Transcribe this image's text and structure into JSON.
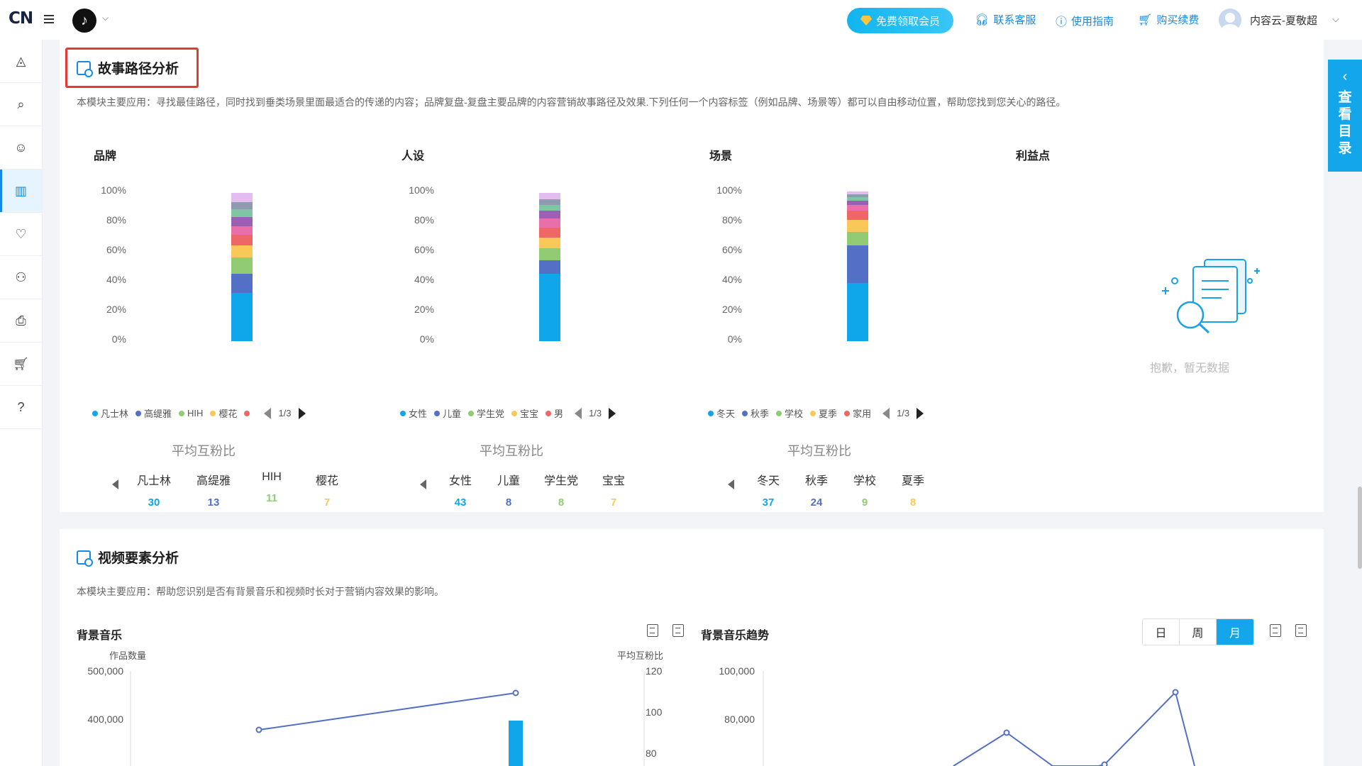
{
  "header": {
    "logo": "CN",
    "app_icon": "tiktok-icon",
    "vip_button": "免费领取会员",
    "links": [
      {
        "label": "联系客服",
        "icon": "headset-icon"
      },
      {
        "label": "使用指南",
        "icon": "help-icon"
      },
      {
        "label": "购买续费",
        "icon": "cart-icon"
      }
    ],
    "user_name": "内容云-夏敬超"
  },
  "sidebar": {
    "items": [
      {
        "icon": "overview-icon"
      },
      {
        "icon": "search-analysis-icon"
      },
      {
        "icon": "face-search-icon"
      },
      {
        "icon": "bar-chart-icon",
        "active": true
      },
      {
        "icon": "heartbeat-icon"
      },
      {
        "icon": "person-icon"
      },
      {
        "icon": "download-doc-icon"
      },
      {
        "icon": "cart-icon"
      },
      {
        "icon": "help-icon"
      }
    ]
  },
  "directory_tab": {
    "label": "查看目录"
  },
  "story_section": {
    "title": "故事路径分析",
    "description": "本模块主要应用：寻找最佳路径，同时找到垂类场景里面最适合的传递的内容；品牌复盘-复盘主要品牌的内容营销故事路径及效果.下列任何一个内容标签（例如品牌、场景等）都可以自由移动位置，帮助您找到您关心的路径。",
    "y_ticks": [
      "100%",
      "80%",
      "60%",
      "40%",
      "20%",
      "0%"
    ],
    "avg_title": "平均互粉比",
    "page_indicator": "1/3",
    "columns": [
      {
        "title": "品牌",
        "legend": [
          {
            "name": "凡士林",
            "color": "#0fa6ea"
          },
          {
            "name": "高缇雅",
            "color": "#5470c6"
          },
          {
            "name": "HIH",
            "color": "#91cc75"
          },
          {
            "name": "樱花",
            "color": "#fac858"
          },
          {
            "name": "",
            "color": "#ee6666"
          }
        ],
        "avg": [
          {
            "label": "凡士林",
            "value": "30",
            "color": "#0fa6ea"
          },
          {
            "label": "高缇雅",
            "value": "13",
            "color": "#5470c6"
          },
          {
            "label": "HIH",
            "value": "11",
            "color": "#91cc75"
          },
          {
            "label": "樱花",
            "value": "7",
            "color": "#fac858"
          }
        ]
      },
      {
        "title": "人设",
        "legend": [
          {
            "name": "女性",
            "color": "#0fa6ea"
          },
          {
            "name": "儿童",
            "color": "#5470c6"
          },
          {
            "name": "学生党",
            "color": "#91cc75"
          },
          {
            "name": "宝宝",
            "color": "#fac858"
          },
          {
            "name": "男",
            "color": "#ee6666"
          }
        ],
        "avg": [
          {
            "label": "女性",
            "value": "43",
            "color": "#0fa6ea"
          },
          {
            "label": "儿童",
            "value": "8",
            "color": "#5470c6"
          },
          {
            "label": "学生党",
            "value": "8",
            "color": "#91cc75"
          },
          {
            "label": "宝宝",
            "value": "7",
            "color": "#fac858"
          }
        ]
      },
      {
        "title": "场景",
        "legend": [
          {
            "name": "冬天",
            "color": "#0fa6ea"
          },
          {
            "name": "秋季",
            "color": "#5470c6"
          },
          {
            "name": "学校",
            "color": "#91cc75"
          },
          {
            "name": "夏季",
            "color": "#fac858"
          },
          {
            "name": "家用",
            "color": "#ee6666"
          }
        ],
        "avg": [
          {
            "label": "冬天",
            "value": "37",
            "color": "#0fa6ea"
          },
          {
            "label": "秋季",
            "value": "24",
            "color": "#5470c6"
          },
          {
            "label": "学校",
            "value": "9",
            "color": "#91cc75"
          },
          {
            "label": "夏季",
            "value": "8",
            "color": "#fac858"
          }
        ]
      },
      {
        "title": "利益点",
        "empty_text": "抱歉，暂无数据"
      }
    ]
  },
  "video_section": {
    "title": "视频要素分析",
    "description": "本模块主要应用：帮助您识别是否有背景音乐和视频时长对于营销内容效果的影响。",
    "bgm": {
      "title": "背景音乐",
      "left_axis_label": "作品数量",
      "right_axis_label": "平均互粉比",
      "left_ticks": [
        "500,000",
        "400,000"
      ],
      "right_ticks": [
        "120",
        "100",
        "80"
      ]
    },
    "bgm_trend": {
      "title": "背景音乐趋势",
      "ticks": [
        "100,000",
        "80,000"
      ],
      "segments": [
        "日",
        "周",
        "月"
      ],
      "active_segment": "月"
    }
  },
  "chart_data": [
    {
      "type": "bar",
      "title": "品牌",
      "stacked": true,
      "ylim": [
        0,
        100
      ],
      "series": [
        {
          "color": "#0fa6ea",
          "value": 32
        },
        {
          "color": "#5470c6",
          "value": 13
        },
        {
          "color": "#91cc75",
          "value": 11
        },
        {
          "color": "#fac858",
          "value": 8
        },
        {
          "color": "#ee6666",
          "value": 7
        },
        {
          "color": "#e86faa",
          "value": 6
        },
        {
          "color": "#9a60b4",
          "value": 6
        },
        {
          "color": "#7fc6a4",
          "value": 5
        },
        {
          "color": "#8e9ab0",
          "value": 5
        },
        {
          "color": "#e3bdf0",
          "value": 6
        }
      ]
    },
    {
      "type": "bar",
      "title": "人设",
      "stacked": true,
      "ylim": [
        0,
        100
      ],
      "series": [
        {
          "color": "#0fa6ea",
          "value": 45
        },
        {
          "color": "#5470c6",
          "value": 9
        },
        {
          "color": "#91cc75",
          "value": 8
        },
        {
          "color": "#fac858",
          "value": 7
        },
        {
          "color": "#ee6666",
          "value": 7
        },
        {
          "color": "#e86faa",
          "value": 6
        },
        {
          "color": "#9a60b4",
          "value": 5
        },
        {
          "color": "#7fc6a4",
          "value": 4
        },
        {
          "color": "#8e9ab0",
          "value": 4
        },
        {
          "color": "#e3bdf0",
          "value": 4
        }
      ]
    },
    {
      "type": "bar",
      "title": "场景",
      "stacked": true,
      "ylim": [
        0,
        100
      ],
      "series": [
        {
          "color": "#0fa6ea",
          "value": 39
        },
        {
          "color": "#5470c6",
          "value": 25
        },
        {
          "color": "#91cc75",
          "value": 9
        },
        {
          "color": "#fac858",
          "value": 8
        },
        {
          "color": "#ee6666",
          "value": 6
        },
        {
          "color": "#e86faa",
          "value": 4
        },
        {
          "color": "#9a60b4",
          "value": 3
        },
        {
          "color": "#7fc6a4",
          "value": 2
        },
        {
          "color": "#8e9ab0",
          "value": 2
        },
        {
          "color": "#e3bdf0",
          "value": 2
        }
      ]
    }
  ]
}
